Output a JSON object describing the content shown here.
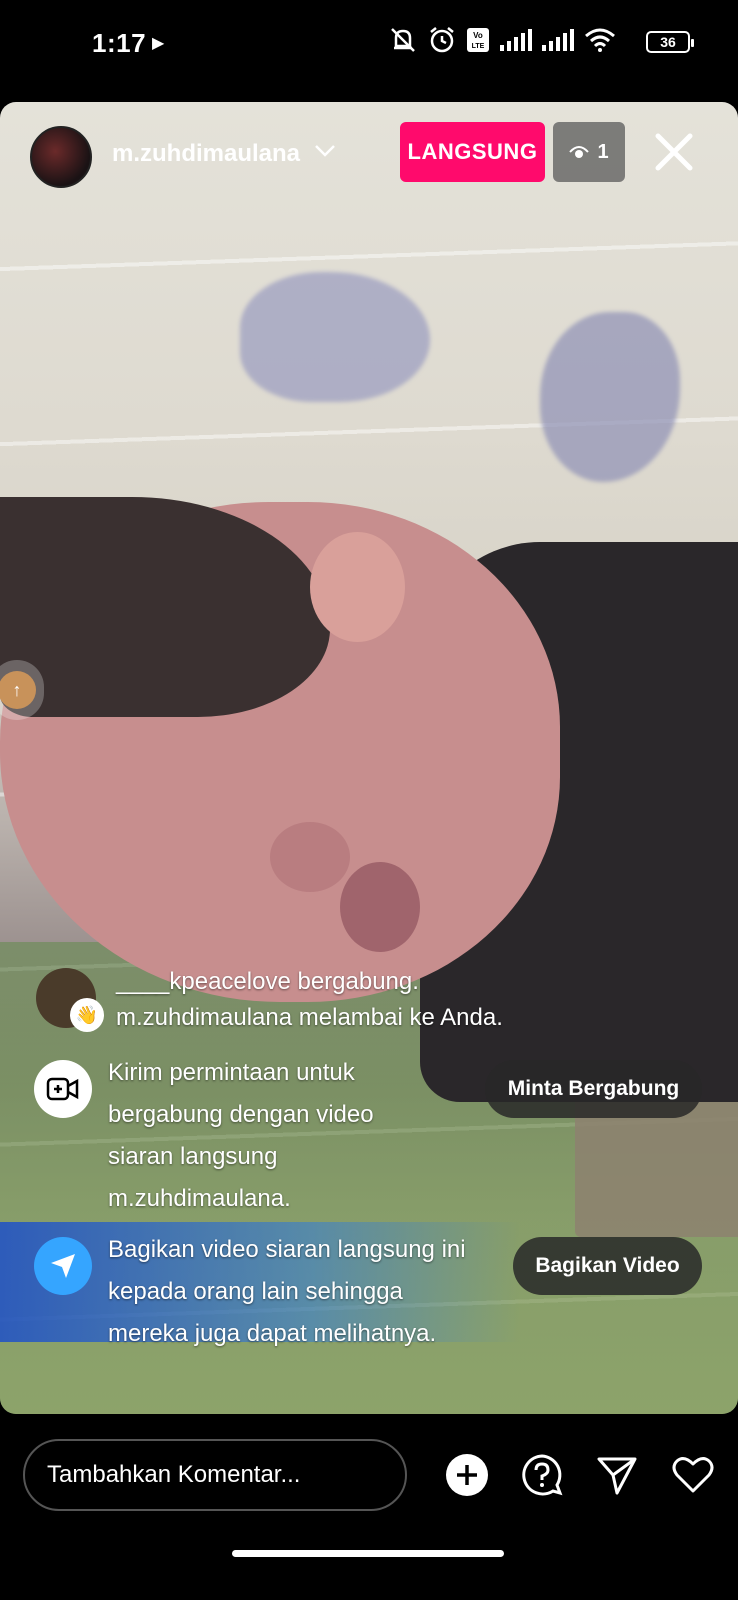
{
  "status_bar": {
    "time": "1:17",
    "battery_level": "36",
    "play_icon": "play-icon",
    "icons": [
      "mute-icon",
      "alarm-icon",
      "volte-icon",
      "signal-icon",
      "signal-icon",
      "wifi-icon",
      "battery-icon"
    ]
  },
  "header": {
    "username": "m.zuhdimaulana",
    "live_label": "LANGSUNG",
    "viewer_count": "1"
  },
  "feed": {
    "join_line1": "____kpeacelove bergabung.",
    "join_line2": "m.zuhdimaulana melambai ke Anda.",
    "request_text": "Kirim permintaan untuk bergabung dengan video siaran langsung m.zuhdimaulana.",
    "request_button": "Minta Bergabung",
    "share_text": "Bagikan video siaran langsung ini kepada orang lain sehingga mereka juga dapat melihatnya.",
    "share_button": "Bagikan Video"
  },
  "bottom": {
    "comment_placeholder": "Tambahkan Komentar..."
  },
  "colors": {
    "live_badge": "#ff0a6c",
    "share_icon_bg": "#35a5ff"
  }
}
